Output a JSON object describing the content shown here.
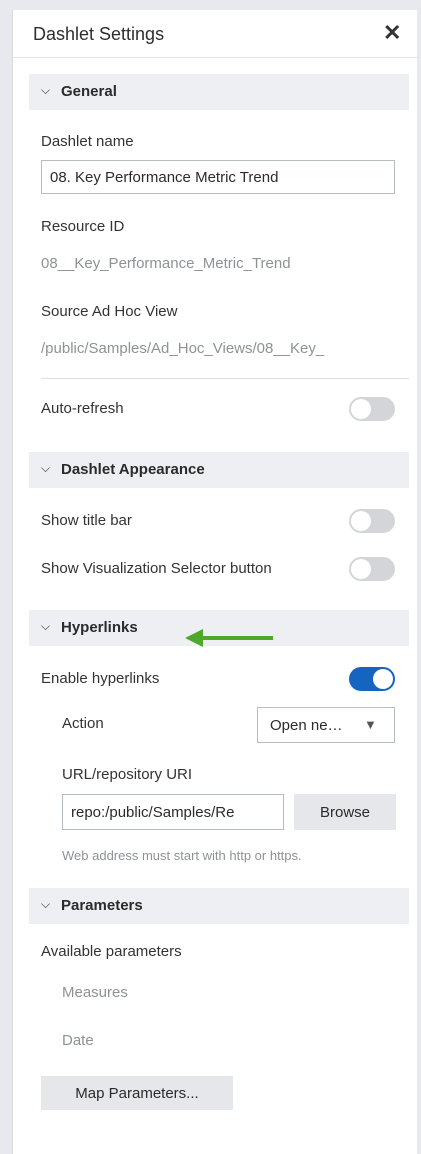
{
  "panel": {
    "title": "Dashlet Settings"
  },
  "sections": {
    "general": {
      "header": "General",
      "dashlet_name_label": "Dashlet name",
      "dashlet_name_value": "08. Key Performance Metric Trend",
      "resource_id_label": "Resource ID",
      "resource_id_value": "08__Key_Performance_Metric_Trend",
      "source_label": "Source Ad Hoc View",
      "source_value": "/public/Samples/Ad_Hoc_Views/08__Key_",
      "auto_refresh_label": "Auto-refresh",
      "auto_refresh_on": false
    },
    "appearance": {
      "header": "Dashlet Appearance",
      "show_title_bar_label": "Show title bar",
      "show_title_bar_on": false,
      "show_viz_selector_label": "Show Visualization Selector button",
      "show_viz_selector_on": false
    },
    "hyperlinks": {
      "header": "Hyperlinks",
      "enable_label": "Enable hyperlinks",
      "enable_on": true,
      "action_label": "Action",
      "action_value": "Open ne…",
      "uri_label": "URL/repository URI",
      "uri_value": "repo:/public/Samples/Re",
      "browse_label": "Browse",
      "hint": "Web address must start with http or https."
    },
    "parameters": {
      "header": "Parameters",
      "available_label": "Available parameters",
      "items": [
        "Measures",
        "Date"
      ],
      "map_button_label": "Map Parameters..."
    }
  },
  "colors": {
    "accent": "#1565c0",
    "arrow": "#4ea82a"
  },
  "icons": {
    "close": "close-icon",
    "chevron": "chevron-down-icon",
    "arrow": "arrow-left-icon",
    "caret": "caret-down-icon"
  }
}
